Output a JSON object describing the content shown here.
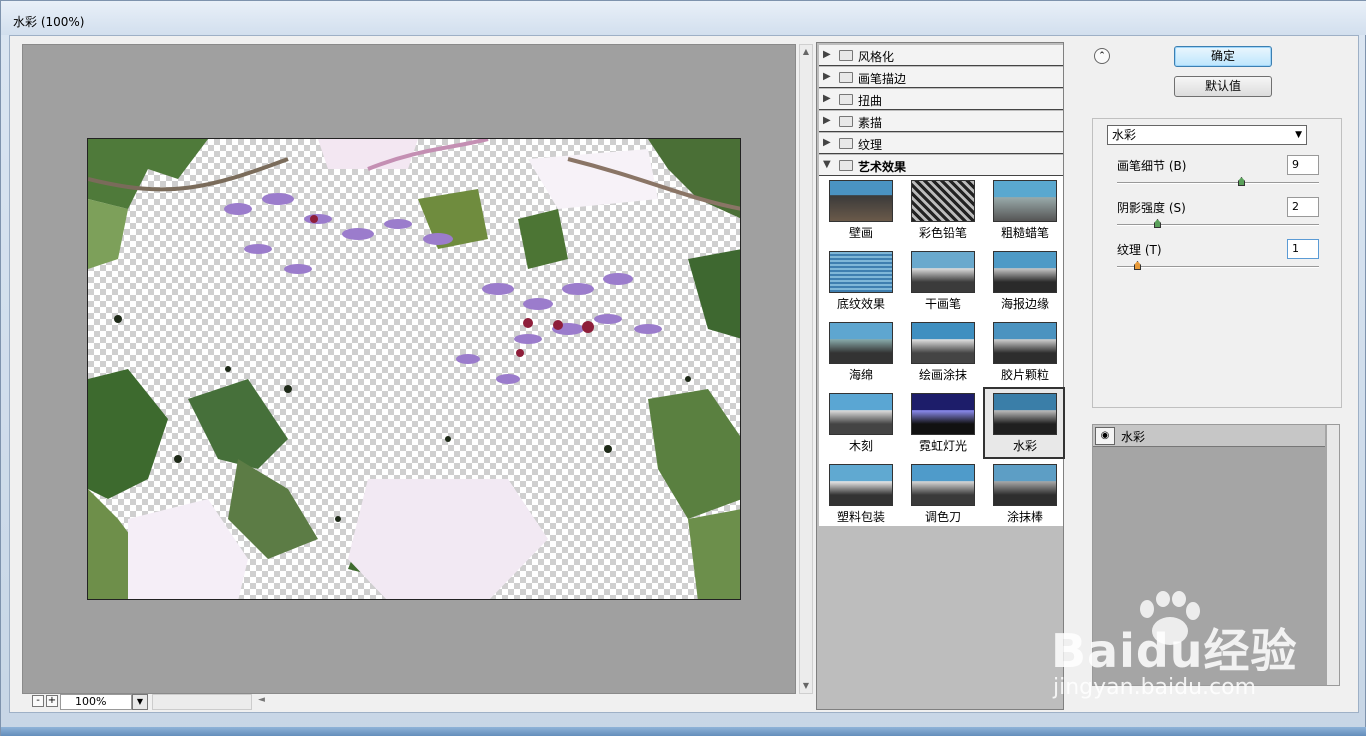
{
  "window": {
    "title": "水彩 (100%)"
  },
  "preview": {
    "zoom_value": "100%",
    "zoom_out_label": "-",
    "zoom_in_label": "+"
  },
  "categories": [
    {
      "label": "风格化",
      "open": false
    },
    {
      "label": "画笔描边",
      "open": false
    },
    {
      "label": "扭曲",
      "open": false
    },
    {
      "label": "素描",
      "open": false
    },
    {
      "label": "纹理",
      "open": false
    },
    {
      "label": "艺术效果",
      "open": true
    }
  ],
  "filters": [
    {
      "label": "壁画",
      "selected": false
    },
    {
      "label": "彩色铅笔",
      "selected": false
    },
    {
      "label": "粗糙蜡笔",
      "selected": false
    },
    {
      "label": "底纹效果",
      "selected": false
    },
    {
      "label": "干画笔",
      "selected": false
    },
    {
      "label": "海报边缘",
      "selected": false
    },
    {
      "label": "海绵",
      "selected": false
    },
    {
      "label": "绘画涂抹",
      "selected": false
    },
    {
      "label": "胶片颗粒",
      "selected": false
    },
    {
      "label": "木刻",
      "selected": false
    },
    {
      "label": "霓虹灯光",
      "selected": false
    },
    {
      "label": "水彩",
      "selected": true
    },
    {
      "label": "塑料包装",
      "selected": false
    },
    {
      "label": "调色刀",
      "selected": false
    },
    {
      "label": "涂抹棒",
      "selected": false
    }
  ],
  "buttons": {
    "ok": "确定",
    "default": "默认值"
  },
  "settings": {
    "filter_select": "水彩",
    "params": [
      {
        "label": "画笔细节 (B)",
        "value": "9",
        "level": 0.62
      },
      {
        "label": "阴影强度 (S)",
        "value": "2",
        "level": 0.2
      },
      {
        "label": "纹理 (T)",
        "value": "1",
        "level": 0.1
      }
    ]
  },
  "layers": {
    "items": [
      {
        "name": "水彩"
      }
    ]
  },
  "watermark": {
    "brand": "Baidu经验",
    "url": "jingyan.baidu.com"
  },
  "colors": {
    "accent": "#3c7fb1",
    "panel": "#f0f0f0",
    "preview_bg": "#a0a0a0"
  }
}
